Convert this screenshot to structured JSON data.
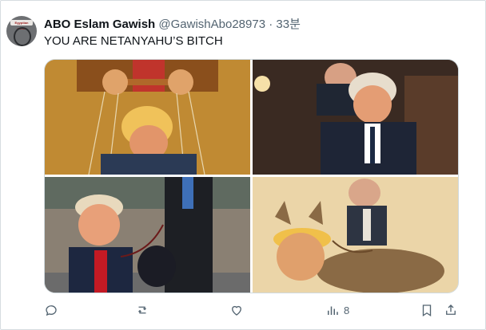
{
  "tweet": {
    "display_name": "ABO Eslam Gawish",
    "handle": "@GawishAbo28973",
    "separator": "·",
    "time": "33분",
    "text": "YOU ARE NETANYAHU’S BITCH"
  },
  "avatar": {
    "caption": "Egyptian ultras"
  },
  "images": [
    {
      "subject": "puppet-master-illustration"
    },
    {
      "subject": "meeting-room-photo"
    },
    {
      "subject": "leash-street-photo"
    },
    {
      "subject": "donkey-rider-cartoon"
    }
  ],
  "actions": {
    "reply": {
      "icon": "reply-icon",
      "count": ""
    },
    "repost": {
      "icon": "repost-icon",
      "count": ""
    },
    "like": {
      "icon": "heart-icon",
      "count": ""
    },
    "views": {
      "icon": "views-icon",
      "count": "8"
    },
    "bookmark": {
      "icon": "bookmark-icon"
    },
    "share": {
      "icon": "share-icon"
    }
  },
  "colors": {
    "text": "#0f1419",
    "muted": "#536471",
    "border": "#cfd9de"
  }
}
